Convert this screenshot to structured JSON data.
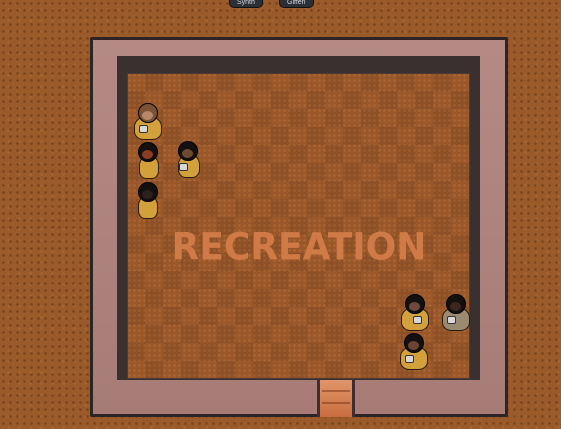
{
  "colonist_tags": [
    "Synth",
    "Giffen"
  ],
  "room": {
    "label": "RECREATION"
  },
  "pawns": [
    {
      "id": "p1",
      "hair": "#7a5236",
      "skin": "#b8876a"
    },
    {
      "id": "p2",
      "hair": "#141010",
      "skin": "#8a3d22"
    },
    {
      "id": "p3",
      "hair": "#141010",
      "skin": "#6e4a33"
    },
    {
      "id": "p4",
      "hair": "#141010",
      "skin": "#2d201a"
    },
    {
      "id": "p5",
      "hair": "#141010",
      "skin": "#6d4a3b"
    },
    {
      "id": "p6",
      "hair": "#141010",
      "skin": "#3c2720"
    },
    {
      "id": "p7",
      "hair": "#141010",
      "skin": "#6b4533"
    }
  ],
  "colors": {
    "floor": "#99572a",
    "wall": "#b58a84",
    "room_label": "#d07a48",
    "shirt": "#d3a13b"
  }
}
